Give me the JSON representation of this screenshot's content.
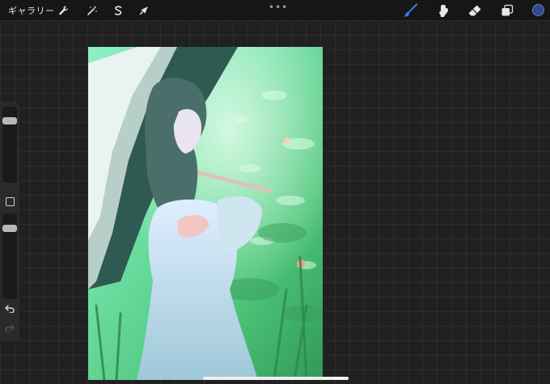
{
  "topbar": {
    "gallery_label": "ギャラリー",
    "more_label": "•••",
    "tools": {
      "actions": "wrench-icon",
      "adjustments": "magic-wand-icon",
      "selection": "selection-s-icon",
      "transform": "arrow-cursor-icon",
      "brush": "brush-icon",
      "smudge": "smudge-icon",
      "eraser": "eraser-icon",
      "layers": "layers-icon"
    },
    "active_tool": "brush",
    "accent_color": "#3a7bff",
    "current_color": "#2e4a8e"
  },
  "sidebar": {
    "brush_size_level": 0.08,
    "opacity_level": 0.08,
    "icons": [
      "modifier-square-icon",
      "undo-icon",
      "redo-icon"
    ]
  }
}
